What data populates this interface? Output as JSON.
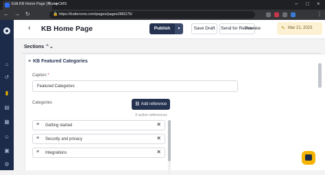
{
  "browser": {
    "tab_title": "Edit KB Home Page | ButterCMS",
    "tab_close": "×",
    "new_tab": "+",
    "url": "https://buttercms.com/pages/pages/386275/",
    "nav_back": "←",
    "nav_forward": "→",
    "nav_reload": "↻",
    "lock": "🔒",
    "win_min": "–",
    "win_max": "□",
    "win_close": "×",
    "menu": "⋮"
  },
  "sidenav": {
    "items": [
      {
        "icon": "home-icon",
        "glyph": "⌂"
      },
      {
        "icon": "recent-icon",
        "glyph": "↺"
      },
      {
        "icon": "pages-icon",
        "glyph": "▮"
      },
      {
        "icon": "doc-icon",
        "glyph": "▤"
      },
      {
        "icon": "grid-icon",
        "glyph": "▦"
      },
      {
        "icon": "users-icon",
        "glyph": "☺"
      },
      {
        "icon": "blog-icon",
        "glyph": "▣"
      },
      {
        "icon": "settings-icon",
        "glyph": "⚙"
      }
    ]
  },
  "header": {
    "back": "‹",
    "title": "KB Home Page",
    "publish": "Publish",
    "publish_caret": "▾",
    "save_draft": "Save Draft",
    "send_review": "Send for Review",
    "preview": "Preview",
    "date": "Mar 21, 2023",
    "pen": "✎"
  },
  "sections": {
    "label": "Sections ⌃⌄",
    "panel_title": "KB Featured Categories",
    "ham": "≡",
    "caption_label": "Caption",
    "caption_required": "*",
    "caption_value": "Featured Categories",
    "categories_label": "Categories",
    "add_reference": "Add reference",
    "link_glyph": "⛓",
    "active_references": "3 active references",
    "references": [
      {
        "label": "Getting started"
      },
      {
        "label": "Security and privacy"
      },
      {
        "label": "Integrations"
      }
    ],
    "grip": "≡",
    "remove": "✕"
  },
  "colors": {
    "brand_navy": "#24324f",
    "sidebar": "#1c2b4a",
    "accent_yellow": "#f4b400"
  }
}
